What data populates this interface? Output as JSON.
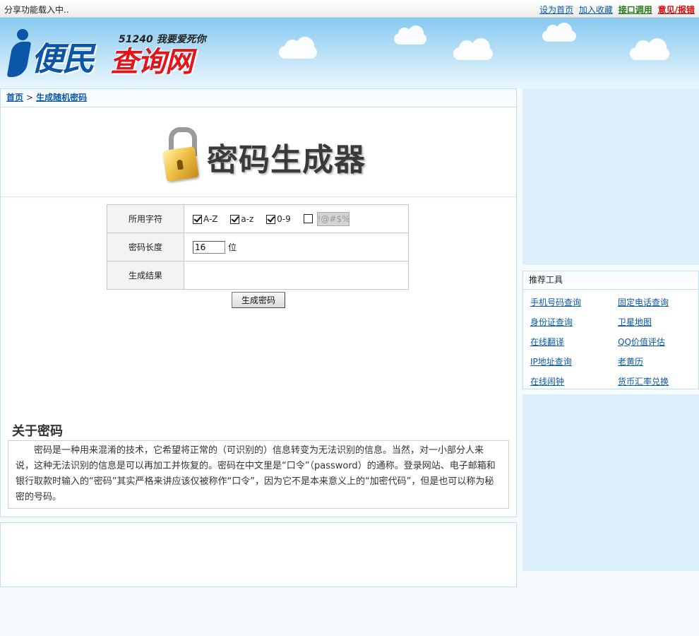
{
  "topbar": {
    "share_status": "分享功能载入中..",
    "links": {
      "set_home": "设为首页",
      "bookmark": "加入收藏",
      "api": "接口调用",
      "feedback": "意见/报错"
    }
  },
  "logo": {
    "name_blue": "便民",
    "name_red": "查询网",
    "slogan": "51240 我要爱死你"
  },
  "breadcrumb": {
    "home": "首页",
    "separator": ">",
    "current": "生成随机密码"
  },
  "banner": {
    "title": "密码生成器",
    "icon": "padlock-icon"
  },
  "form": {
    "charset_label": "所用字符",
    "charsets": [
      {
        "label": "A-Z",
        "checked": true
      },
      {
        "label": "a-z",
        "checked": true
      },
      {
        "label": "0-9",
        "checked": true
      },
      {
        "label": "!@#$%",
        "checked": false
      }
    ],
    "length_label": "密码长度",
    "length_value": "16",
    "length_unit": "位",
    "result_label": "生成结果",
    "result_value": "",
    "generate_button": "生成密码"
  },
  "about": {
    "title": "关于密码",
    "text": "密码是一种用来混淆的技术，它希望将正常的（可识别的）信息转变为无法识别的信息。当然，对一小部分人来说，这种无法识别的信息是可以再加工并恢复的。密码在中文里是“口令”（password）的通称。登录网站、电子邮箱和银行取款时输入的“密码”其实严格来讲应该仅被称作“口令”，因为它不是本来意义上的“加密代码”，但是也可以称为秘密的号码。"
  },
  "sidebar": {
    "tools_title": "推荐工具",
    "tools": [
      "手机号码查询",
      "固定电话查询",
      "身份证查询",
      "卫星地图",
      "在线翻译",
      "QQ价值评估",
      "IP地址查询",
      "老黄历",
      "在线闹钟",
      "货币汇率兑换"
    ]
  },
  "colors": {
    "link": "#0b58a6",
    "api_link": "#2a7a1a",
    "feedback_link": "#d01010",
    "panel_border": "#bfe0ee",
    "sidebar_bg": "#dcf0fb"
  }
}
